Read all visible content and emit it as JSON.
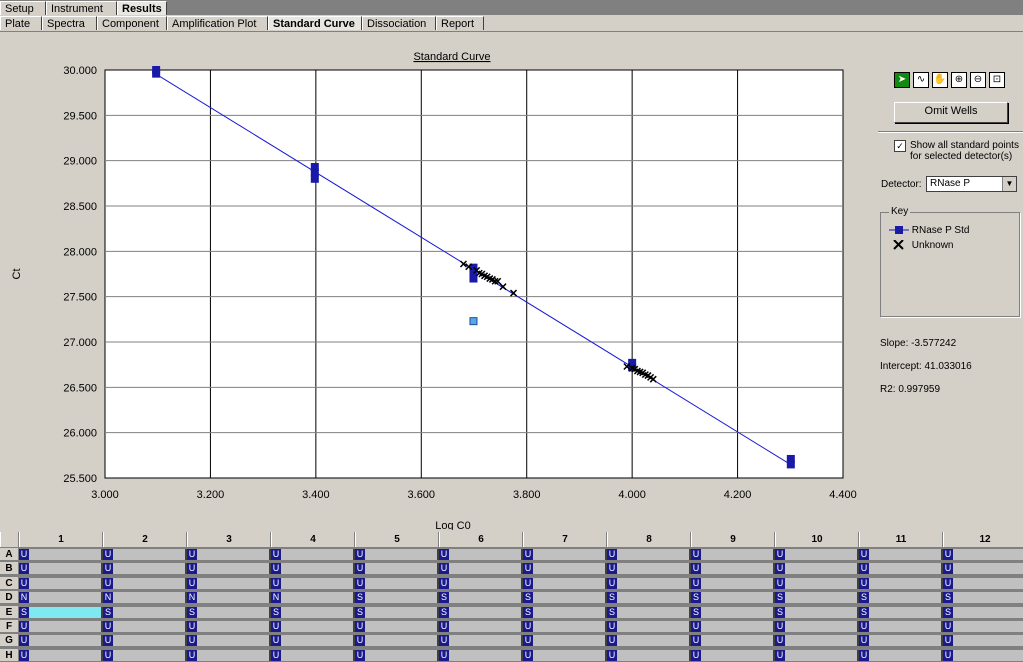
{
  "top_tabs": [
    "Setup",
    "Instrument",
    "Results"
  ],
  "top_tabs_active": 2,
  "sub_tabs": [
    "Plate",
    "Spectra",
    "Component",
    "Amplification Plot",
    "Standard Curve",
    "Dissociation",
    "Report"
  ],
  "sub_tabs_active": 4,
  "chart_data": {
    "type": "scatter",
    "title": "Standard Curve",
    "xlabel": "Log C0",
    "ylabel": "Ct",
    "xlim": [
      3.0,
      4.4
    ],
    "ylim": [
      25.5,
      30.0
    ],
    "x_ticks": [
      "3.000",
      "3.200",
      "3.400",
      "3.600",
      "3.800",
      "4.000",
      "4.200",
      "4.400"
    ],
    "y_ticks": [
      "30.000",
      "29.500",
      "29.000",
      "28.500",
      "28.000",
      "27.500",
      "27.000",
      "26.500",
      "26.000",
      "25.500"
    ],
    "grid": true,
    "fit_line": {
      "slope": -3.577242,
      "intercept": 41.033016,
      "x_range": [
        3.097,
        4.301
      ]
    },
    "series": [
      {
        "name": "RNase P Std",
        "color": "#1a1aa8",
        "points": [
          [
            3.097,
            29.96
          ],
          [
            3.097,
            30.0
          ],
          [
            3.398,
            28.93
          ],
          [
            3.398,
            28.87
          ],
          [
            3.398,
            28.8
          ],
          [
            3.699,
            27.82
          ],
          [
            3.699,
            27.77
          ],
          [
            3.699,
            27.7
          ],
          [
            4.0,
            26.77
          ],
          [
            4.0,
            26.72
          ],
          [
            4.301,
            25.71
          ],
          [
            4.301,
            25.65
          ]
        ]
      },
      {
        "name": "Unknown",
        "color": "#000000",
        "points": [
          [
            3.68,
            27.86
          ],
          [
            3.69,
            27.83
          ],
          [
            3.705,
            27.79
          ],
          [
            3.71,
            27.76
          ],
          [
            3.715,
            27.75
          ],
          [
            3.72,
            27.73
          ],
          [
            3.725,
            27.72
          ],
          [
            3.73,
            27.7
          ],
          [
            3.735,
            27.69
          ],
          [
            3.74,
            27.67
          ],
          [
            3.745,
            27.67
          ],
          [
            3.755,
            27.61
          ],
          [
            3.775,
            27.54
          ],
          [
            3.99,
            26.73
          ],
          [
            4.0,
            26.71
          ],
          [
            4.005,
            26.7
          ],
          [
            4.01,
            26.68
          ],
          [
            4.015,
            26.67
          ],
          [
            4.02,
            26.66
          ],
          [
            4.025,
            26.64
          ],
          [
            4.03,
            26.63
          ],
          [
            4.035,
            26.61
          ],
          [
            4.04,
            26.59
          ]
        ]
      },
      {
        "name": "Omitted",
        "color": "#5aa6e6",
        "points": [
          [
            3.699,
            27.23
          ]
        ]
      }
    ]
  },
  "toolbar": {
    "tools": [
      "pointer-icon",
      "lasso-icon",
      "hand-icon",
      "zoom-in-icon",
      "zoom-out-icon",
      "zoom-fit-icon"
    ],
    "glyphs": [
      "➤",
      "∿",
      "✋",
      "⊕",
      "⊖",
      "⊡"
    ],
    "omit_wells_label": "Omit Wells"
  },
  "options": {
    "show_all_label": "Show all standard points for selected detector(s)",
    "show_all_checked": "✓",
    "detector_label": "Detector:",
    "detector_value": "RNase P"
  },
  "key": {
    "title": "Key",
    "items": [
      "RNase P Std",
      "Unknown"
    ]
  },
  "stats": {
    "slope": "Slope:  -3.577242",
    "intercept": "Intercept:  41.033016",
    "r2": "R2:  0.997959"
  },
  "plate": {
    "columns": [
      "1",
      "2",
      "3",
      "4",
      "5",
      "6",
      "7",
      "8",
      "9",
      "10",
      "11",
      "12"
    ],
    "rows": [
      {
        "label": "A",
        "wells": [
          "U",
          "U",
          "U",
          "U",
          "U",
          "U",
          "U",
          "U",
          "U",
          "U",
          "U",
          "U"
        ]
      },
      {
        "label": "B",
        "wells": [
          "U",
          "U",
          "U",
          "U",
          "U",
          "U",
          "U",
          "U",
          "U",
          "U",
          "U",
          "U"
        ]
      },
      {
        "label": "C",
        "wells": [
          "U",
          "U",
          "U",
          "U",
          "U",
          "U",
          "U",
          "U",
          "U",
          "U",
          "U",
          "U"
        ]
      },
      {
        "label": "D",
        "wells": [
          "N",
          "N",
          "N",
          "N",
          "S",
          "S",
          "S",
          "S",
          "S",
          "S",
          "S",
          "S"
        ]
      },
      {
        "label": "E",
        "wells": [
          "S",
          "S",
          "S",
          "S",
          "S",
          "S",
          "S",
          "S",
          "S",
          "S",
          "S",
          "S"
        ]
      },
      {
        "label": "F",
        "wells": [
          "U",
          "U",
          "U",
          "U",
          "U",
          "U",
          "U",
          "U",
          "U",
          "U",
          "U",
          "U"
        ]
      },
      {
        "label": "G",
        "wells": [
          "U",
          "U",
          "U",
          "U",
          "U",
          "U",
          "U",
          "U",
          "U",
          "U",
          "U",
          "U"
        ]
      },
      {
        "label": "H",
        "wells": [
          "U",
          "U",
          "U",
          "U",
          "U",
          "U",
          "U",
          "U",
          "U",
          "U",
          "U",
          "U"
        ]
      }
    ],
    "selected_well": "E1"
  }
}
